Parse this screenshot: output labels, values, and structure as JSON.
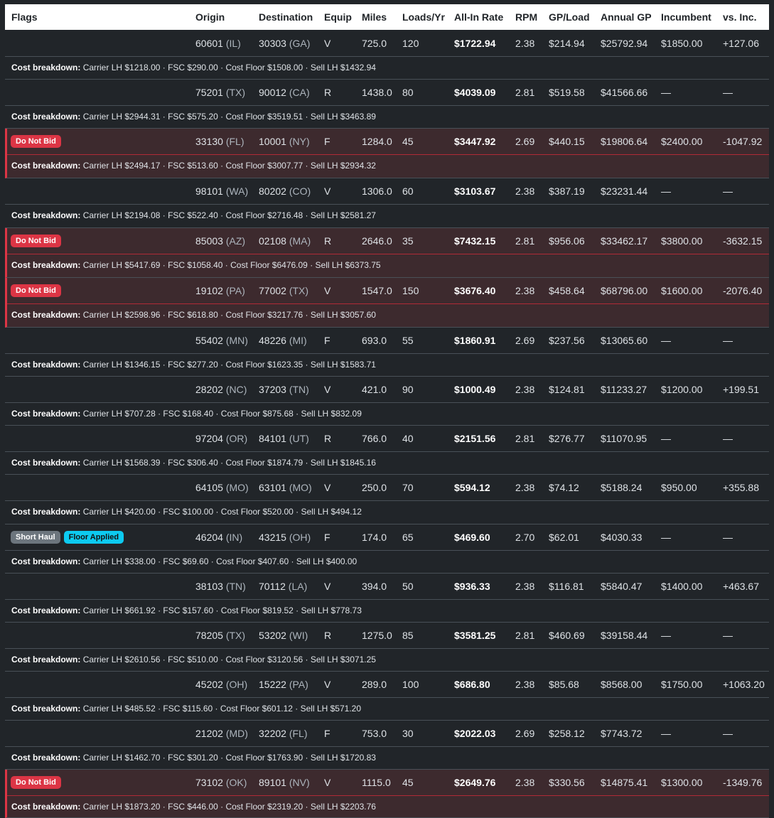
{
  "header": [
    "Flags",
    "Origin",
    "Destination",
    "Equip",
    "Miles",
    "Loads/Yr",
    "All-In Rate",
    "RPM",
    "GP/Load",
    "Annual GP",
    "Incumbent",
    "vs. Inc."
  ],
  "breakdown_label": "Cost breakdown:",
  "colors": {
    "dnb_badge": "#dc3545",
    "short_haul_badge": "#6c757d",
    "floor_badge": "#0dcaf0",
    "positive": "#28a745",
    "negative": "#e0525f"
  },
  "rows": [
    {
      "flags": [],
      "ozip": "60601",
      "ost": "(IL)",
      "dzip": "30303",
      "dst": "(GA)",
      "equip": "V",
      "miles": "725.0",
      "loads": "120",
      "rate": "$1722.94",
      "rpm": "2.38",
      "gp": "$214.94",
      "agp": "$25792.94",
      "inc": "$1850.00",
      "vs": "+127.06",
      "vs_sign": "pos",
      "breakdown": "Carrier LH $1218.00 · FSC $290.00 · Cost Floor $1508.00 · Sell LH $1432.94"
    },
    {
      "flags": [],
      "ozip": "75201",
      "ost": "(TX)",
      "dzip": "90012",
      "dst": "(CA)",
      "equip": "R",
      "miles": "1438.0",
      "loads": "80",
      "rate": "$4039.09",
      "rpm": "2.81",
      "gp": "$519.58",
      "agp": "$41566.66",
      "inc": "—",
      "vs": "—",
      "vs_sign": "none",
      "breakdown": "Carrier LH $2944.31 · FSC $575.20 · Cost Floor $3519.51 · Sell LH $3463.89"
    },
    {
      "flags": [
        "Do Not Bid"
      ],
      "ozip": "33130",
      "ost": "(FL)",
      "dzip": "10001",
      "dst": "(NY)",
      "equip": "F",
      "miles": "1284.0",
      "loads": "45",
      "rate": "$3447.92",
      "rpm": "2.69",
      "gp": "$440.15",
      "agp": "$19806.64",
      "inc": "$2400.00",
      "vs": "-1047.92",
      "vs_sign": "neg",
      "breakdown": "Carrier LH $2494.17 · FSC $513.60 · Cost Floor $3007.77 · Sell LH $2934.32"
    },
    {
      "flags": [],
      "ozip": "98101",
      "ost": "(WA)",
      "dzip": "80202",
      "dst": "(CO)",
      "equip": "V",
      "miles": "1306.0",
      "loads": "60",
      "rate": "$3103.67",
      "rpm": "2.38",
      "gp": "$387.19",
      "agp": "$23231.44",
      "inc": "—",
      "vs": "—",
      "vs_sign": "none",
      "breakdown": "Carrier LH $2194.08 · FSC $522.40 · Cost Floor $2716.48 · Sell LH $2581.27"
    },
    {
      "flags": [
        "Do Not Bid"
      ],
      "ozip": "85003",
      "ost": "(AZ)",
      "dzip": "02108",
      "dst": "(MA)",
      "equip": "R",
      "miles": "2646.0",
      "loads": "35",
      "rate": "$7432.15",
      "rpm": "2.81",
      "gp": "$956.06",
      "agp": "$33462.17",
      "inc": "$3800.00",
      "vs": "-3632.15",
      "vs_sign": "neg",
      "breakdown": "Carrier LH $5417.69 · FSC $1058.40 · Cost Floor $6476.09 · Sell LH $6373.75"
    },
    {
      "flags": [
        "Do Not Bid"
      ],
      "ozip": "19102",
      "ost": "(PA)",
      "dzip": "77002",
      "dst": "(TX)",
      "equip": "V",
      "miles": "1547.0",
      "loads": "150",
      "rate": "$3676.40",
      "rpm": "2.38",
      "gp": "$458.64",
      "agp": "$68796.00",
      "inc": "$1600.00",
      "vs": "-2076.40",
      "vs_sign": "neg",
      "breakdown": "Carrier LH $2598.96 · FSC $618.80 · Cost Floor $3217.76 · Sell LH $3057.60"
    },
    {
      "flags": [],
      "ozip": "55402",
      "ost": "(MN)",
      "dzip": "48226",
      "dst": "(MI)",
      "equip": "F",
      "miles": "693.0",
      "loads": "55",
      "rate": "$1860.91",
      "rpm": "2.69",
      "gp": "$237.56",
      "agp": "$13065.60",
      "inc": "—",
      "vs": "—",
      "vs_sign": "none",
      "breakdown": "Carrier LH $1346.15 · FSC $277.20 · Cost Floor $1623.35 · Sell LH $1583.71"
    },
    {
      "flags": [],
      "ozip": "28202",
      "ost": "(NC)",
      "dzip": "37203",
      "dst": "(TN)",
      "equip": "V",
      "miles": "421.0",
      "loads": "90",
      "rate": "$1000.49",
      "rpm": "2.38",
      "gp": "$124.81",
      "agp": "$11233.27",
      "inc": "$1200.00",
      "vs": "+199.51",
      "vs_sign": "pos",
      "breakdown": "Carrier LH $707.28 · FSC $168.40 · Cost Floor $875.68 · Sell LH $832.09"
    },
    {
      "flags": [],
      "ozip": "97204",
      "ost": "(OR)",
      "dzip": "84101",
      "dst": "(UT)",
      "equip": "R",
      "miles": "766.0",
      "loads": "40",
      "rate": "$2151.56",
      "rpm": "2.81",
      "gp": "$276.77",
      "agp": "$11070.95",
      "inc": "—",
      "vs": "—",
      "vs_sign": "none",
      "breakdown": "Carrier LH $1568.39 · FSC $306.40 · Cost Floor $1874.79 · Sell LH $1845.16"
    },
    {
      "flags": [],
      "ozip": "64105",
      "ost": "(MO)",
      "dzip": "63101",
      "dst": "(MO)",
      "equip": "V",
      "miles": "250.0",
      "loads": "70",
      "rate": "$594.12",
      "rpm": "2.38",
      "gp": "$74.12",
      "agp": "$5188.24",
      "inc": "$950.00",
      "vs": "+355.88",
      "vs_sign": "pos",
      "breakdown": "Carrier LH $420.00 · FSC $100.00 · Cost Floor $520.00 · Sell LH $494.12"
    },
    {
      "flags": [
        "Short Haul",
        "Floor Applied"
      ],
      "ozip": "46204",
      "ost": "(IN)",
      "dzip": "43215",
      "dst": "(OH)",
      "equip": "F",
      "miles": "174.0",
      "loads": "65",
      "rate": "$469.60",
      "rpm": "2.70",
      "gp": "$62.01",
      "agp": "$4030.33",
      "inc": "—",
      "vs": "—",
      "vs_sign": "none",
      "breakdown": "Carrier LH $338.00 · FSC $69.60 · Cost Floor $407.60 · Sell LH $400.00"
    },
    {
      "flags": [],
      "ozip": "38103",
      "ost": "(TN)",
      "dzip": "70112",
      "dst": "(LA)",
      "equip": "V",
      "miles": "394.0",
      "loads": "50",
      "rate": "$936.33",
      "rpm": "2.38",
      "gp": "$116.81",
      "agp": "$5840.47",
      "inc": "$1400.00",
      "vs": "+463.67",
      "vs_sign": "pos",
      "breakdown": "Carrier LH $661.92 · FSC $157.60 · Cost Floor $819.52 · Sell LH $778.73"
    },
    {
      "flags": [],
      "ozip": "78205",
      "ost": "(TX)",
      "dzip": "53202",
      "dst": "(WI)",
      "equip": "R",
      "miles": "1275.0",
      "loads": "85",
      "rate": "$3581.25",
      "rpm": "2.81",
      "gp": "$460.69",
      "agp": "$39158.44",
      "inc": "—",
      "vs": "—",
      "vs_sign": "none",
      "breakdown": "Carrier LH $2610.56 · FSC $510.00 · Cost Floor $3120.56 · Sell LH $3071.25"
    },
    {
      "flags": [],
      "ozip": "45202",
      "ost": "(OH)",
      "dzip": "15222",
      "dst": "(PA)",
      "equip": "V",
      "miles": "289.0",
      "loads": "100",
      "rate": "$686.80",
      "rpm": "2.38",
      "gp": "$85.68",
      "agp": "$8568.00",
      "inc": "$1750.00",
      "vs": "+1063.20",
      "vs_sign": "pos",
      "breakdown": "Carrier LH $485.52 · FSC $115.60 · Cost Floor $601.12 · Sell LH $571.20"
    },
    {
      "flags": [],
      "ozip": "21202",
      "ost": "(MD)",
      "dzip": "32202",
      "dst": "(FL)",
      "equip": "F",
      "miles": "753.0",
      "loads": "30",
      "rate": "$2022.03",
      "rpm": "2.69",
      "gp": "$258.12",
      "agp": "$7743.72",
      "inc": "—",
      "vs": "—",
      "vs_sign": "none",
      "breakdown": "Carrier LH $1462.70 · FSC $301.20 · Cost Floor $1763.90 · Sell LH $1720.83"
    },
    {
      "flags": [
        "Do Not Bid"
      ],
      "ozip": "73102",
      "ost": "(OK)",
      "dzip": "89101",
      "dst": "(NV)",
      "equip": "V",
      "miles": "1115.0",
      "loads": "45",
      "rate": "$2649.76",
      "rpm": "2.38",
      "gp": "$330.56",
      "agp": "$14875.41",
      "inc": "$1300.00",
      "vs": "-1349.76",
      "vs_sign": "neg",
      "breakdown": "Carrier LH $1873.20 · FSC $446.00 · Cost Floor $2319.20 · Sell LH $2203.76"
    }
  ]
}
